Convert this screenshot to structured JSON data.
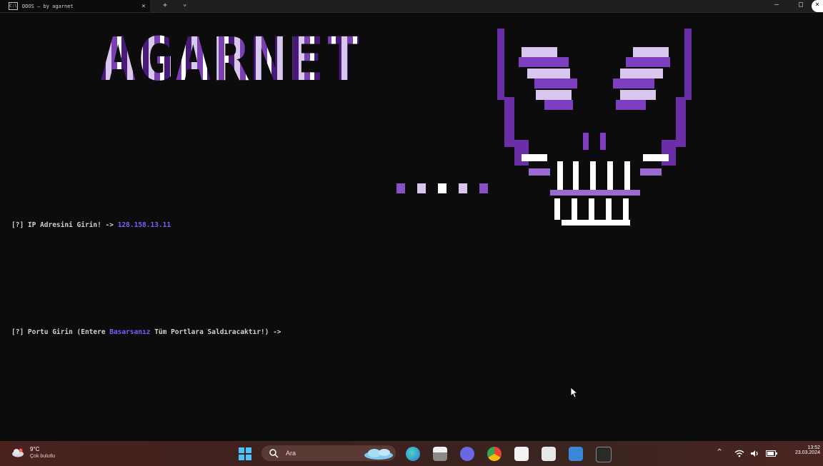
{
  "window": {
    "tab_icon": "C:\\",
    "tab_title": "DDOS — by agarnet",
    "tab_close": "×",
    "new_tab": "+",
    "tab_dropdown": "⌄",
    "minimize": "—",
    "maximize": "□",
    "close": "×"
  },
  "terminal": {
    "banner_text": "AGARNET",
    "ip_prompt": {
      "prefix": "[?] IP Adresini Girin! -> ",
      "value": "128.158.13.11"
    },
    "port_prompt": {
      "prefix": "[?] Portu Girin (Entere ",
      "accent": "Basarsanız",
      "suffix": " Tüm Portlara Saldıracaktır!) ->"
    }
  },
  "taskbar": {
    "weather_temp": "9°C",
    "weather_condition": "Çok bulutlu",
    "search_label": "Ara",
    "tray_chevron": "^",
    "clock_time": "13:52",
    "clock_date": "23.03.2024",
    "apps": [
      "start-icon",
      "widgets-icon",
      "file-explorer-icon",
      "chat-icon",
      "chrome-icon",
      "store-icon",
      "photos-icon",
      "mail-icon",
      "terminal-icon"
    ]
  },
  "colors": {
    "background": "#0c0c0c",
    "accent_purple": "#7a5cff",
    "banner_purple": "#8a4fc4"
  }
}
